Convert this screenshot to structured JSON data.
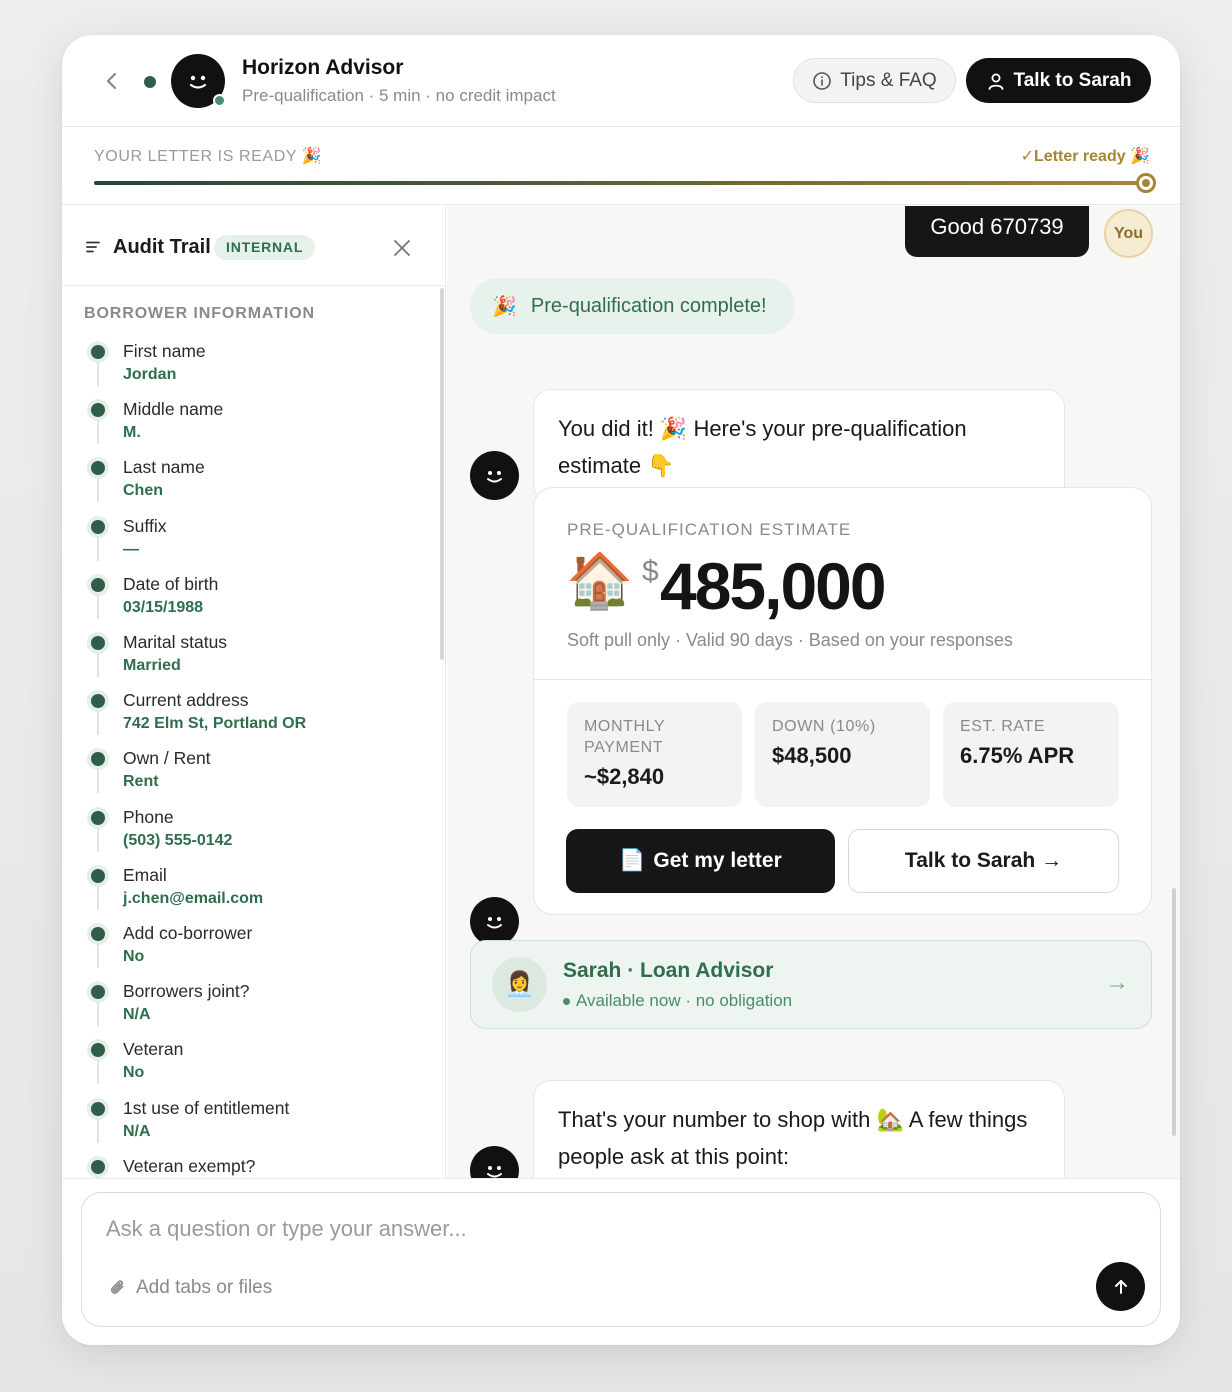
{
  "header": {
    "title": "Horizon Advisor",
    "subtitle": "Pre-qualification · 5 min · no credit impact",
    "tips_label": "Tips & FAQ",
    "talk_label": "Talk to Sarah"
  },
  "progress": {
    "label": "YOUR LETTER IS READY 🎉",
    "status": "✓Letter ready 🎉",
    "fraction": 1.0
  },
  "sidebar": {
    "title": "Audit Trail",
    "badge": "INTERNAL",
    "section": "BORROWER INFORMATION",
    "fields": [
      {
        "label": "First name",
        "value": "Jordan"
      },
      {
        "label": "Middle name",
        "value": "M."
      },
      {
        "label": "Last name",
        "value": "Chen"
      },
      {
        "label": "Suffix",
        "value": "—"
      },
      {
        "label": "Date of birth",
        "value": "03/15/1988"
      },
      {
        "label": "Marital status",
        "value": "Married"
      },
      {
        "label": "Current address",
        "value": "742 Elm St, Portland OR"
      },
      {
        "label": "Own / Rent",
        "value": "Rent"
      },
      {
        "label": "Phone",
        "value": "(503) 555-0142"
      },
      {
        "label": "Email",
        "value": "j.chen@email.com"
      },
      {
        "label": "Add co-borrower",
        "value": "No"
      },
      {
        "label": "Borrowers joint?",
        "value": "N/A"
      },
      {
        "label": "Veteran",
        "value": "No"
      },
      {
        "label": "1st use of entitlement",
        "value": "N/A"
      },
      {
        "label": "Veteran exempt?",
        "value": ""
      }
    ]
  },
  "chat": {
    "user_message": "Good 670739",
    "user_avatar": "You",
    "complete_pill": "Pre-qualification complete!",
    "complete_emoji": "🎉",
    "msg1": "You did it! 🎉 Here's your pre-qualification estimate 👇",
    "card": {
      "label": "PRE-QUALIFICATION ESTIMATE",
      "emoji": "🏠",
      "currency": "$",
      "amount": "485,000",
      "note": "Soft pull only · Valid 90 days · Based on your responses",
      "stats": [
        {
          "key": "MONTHLY PAYMENT",
          "value": "~$2,840"
        },
        {
          "key": "DOWN (10%)",
          "value": "$48,500"
        },
        {
          "key": "EST. RATE",
          "value": "6.75% APR"
        }
      ],
      "primary_button": "Get my letter",
      "primary_icon": "📄",
      "secondary_button": "Talk to Sarah →"
    },
    "advisor": {
      "emoji": "👩‍💼",
      "name": "Sarah · Loan Advisor",
      "status": "Available now · no obligation",
      "arrow": "→"
    },
    "msg2": "That's your number to shop with 🏡 A few things people ask at this point:"
  },
  "composer": {
    "placeholder": "Ask a question or type your answer...",
    "attach_label": "Add tabs or files"
  },
  "colors": {
    "accent_green": "#2f6e4c",
    "gold": "#a88536",
    "dark": "#111111"
  }
}
